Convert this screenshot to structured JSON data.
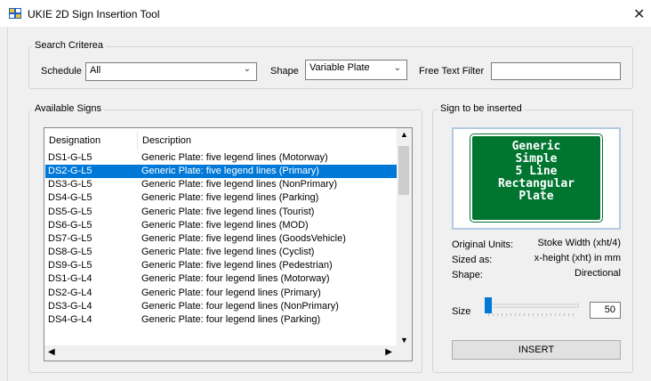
{
  "window": {
    "title": "UKIE 2D Sign Insertion Tool",
    "close_glyph": "✕",
    "icon": "app-grid-icon"
  },
  "search": {
    "group_label": "Search Criterea",
    "schedule_label": "Schedule",
    "schedule_value": "All",
    "shape_label": "Shape",
    "shape_value": "Variable Plate",
    "free_text_label": "Free Text Filter",
    "free_text_value": ""
  },
  "available": {
    "group_label": "Available Signs",
    "columns": [
      "Designation",
      "Description"
    ],
    "selected_index": 1,
    "rows": [
      [
        "DS1-G-L5",
        "Generic Plate: five legend lines (Motorway)"
      ],
      [
        "DS2-G-L5",
        "Generic Plate: five legend lines (Primary)"
      ],
      [
        "DS3-G-L5",
        "Generic Plate: five legend lines (NonPrimary)"
      ],
      [
        "DS4-G-L5",
        "Generic Plate: five legend lines (Parking)"
      ],
      [
        "DS5-G-L5",
        "Generic Plate: five legend lines (Tourist)"
      ],
      [
        "DS6-G-L5",
        "Generic Plate: five legend lines (MOD)"
      ],
      [
        "DS7-G-L5",
        "Generic Plate: five legend lines (GoodsVehicle)"
      ],
      [
        "DS8-G-L5",
        "Generic Plate: five legend lines (Cyclist)"
      ],
      [
        "DS9-G-L5",
        "Generic Plate: five legend lines (Pedestrian)"
      ],
      [
        "DS1-G-L4",
        "Generic Plate: four legend lines (Motorway)"
      ],
      [
        "DS2-G-L4",
        "Generic Plate: four legend lines (Primary)"
      ],
      [
        "DS3-G-L4",
        "Generic Plate: four legend lines (NonPrimary)"
      ],
      [
        "DS4-G-L4",
        "Generic Plate: four legend lines (Parking)"
      ]
    ]
  },
  "insert": {
    "group_label": "Sign to be inserted",
    "sign_lines": [
      "Generic",
      "Simple",
      "5 Line",
      "Rectangular",
      "Plate"
    ],
    "sign_color": "#007530",
    "original_units_label": "Original Units:",
    "original_units_value": "Stoke Width (xht/4)",
    "sized_as_label": "Sized as:",
    "sized_as_value": "x-height (xht) in mm",
    "shape_label": "Shape:",
    "shape_value": "Directional",
    "size_label": "Size",
    "size_value": "50",
    "insert_button": "INSERT"
  }
}
